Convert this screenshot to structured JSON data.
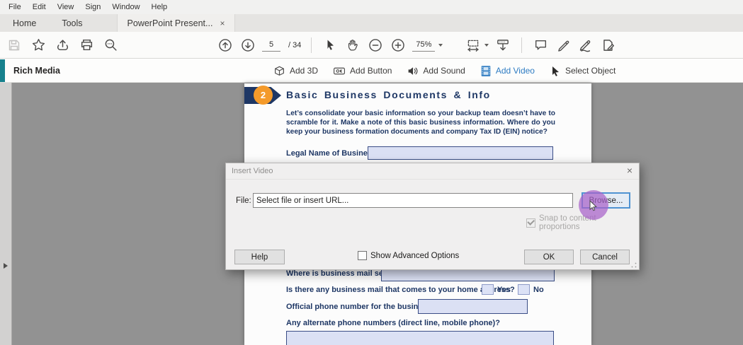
{
  "menu": {
    "items": [
      "File",
      "Edit",
      "View",
      "Sign",
      "Window",
      "Help"
    ]
  },
  "tabs": {
    "home": "Home",
    "tools": "Tools",
    "document": "PowerPoint Present...",
    "close_glyph": "×"
  },
  "toolbar": {
    "page_current": "5",
    "page_total": "/ 34",
    "zoom_level": "75%"
  },
  "richmedia": {
    "title": "Rich Media",
    "tools": [
      {
        "label": "Add 3D"
      },
      {
        "label": "Add Button"
      },
      {
        "label": "Add Sound"
      },
      {
        "label": "Add Video"
      },
      {
        "label": "Select Object"
      }
    ]
  },
  "document": {
    "step_number": "2",
    "heading": "Basic Business Documents & Info",
    "intro": "Let’s consolidate your basic information so your backup team doesn’t have to scramble for it. Make a note of this basic business information. Where do you keep your business formation documents and company Tax ID (EIN) notice?",
    "fields": {
      "legal_name_label": "Legal Name of Business:",
      "mail_sent_label": "Where is business mail sent?",
      "home_address_label": "Is there any business mail that comes to your home address?",
      "yes_label": "Yes",
      "no_label": "No",
      "phone_label": "Official phone number for the business:",
      "alt_phone_label": "Any alternate phone numbers (direct line, mobile phone)?"
    }
  },
  "dialog": {
    "title": "Insert Video",
    "close_glyph": "×",
    "file_label": "File:",
    "file_placeholder": "Select file or insert URL...",
    "browse_label": "Browse...",
    "snap_label": "Snap to content proportions",
    "help_label": "Help",
    "advanced_label": "Show Advanced Options",
    "ok_label": "OK",
    "cancel_label": "Cancel"
  },
  "colors": {
    "accent_teal": "#17818d",
    "selected_blue": "#2e7cc3",
    "doc_navy": "#1e3765",
    "field_fill": "#dbe0f4",
    "field_border": "#3a4d85",
    "step_orange": "#f49a2a",
    "highlight_purple": "#a761c9"
  }
}
